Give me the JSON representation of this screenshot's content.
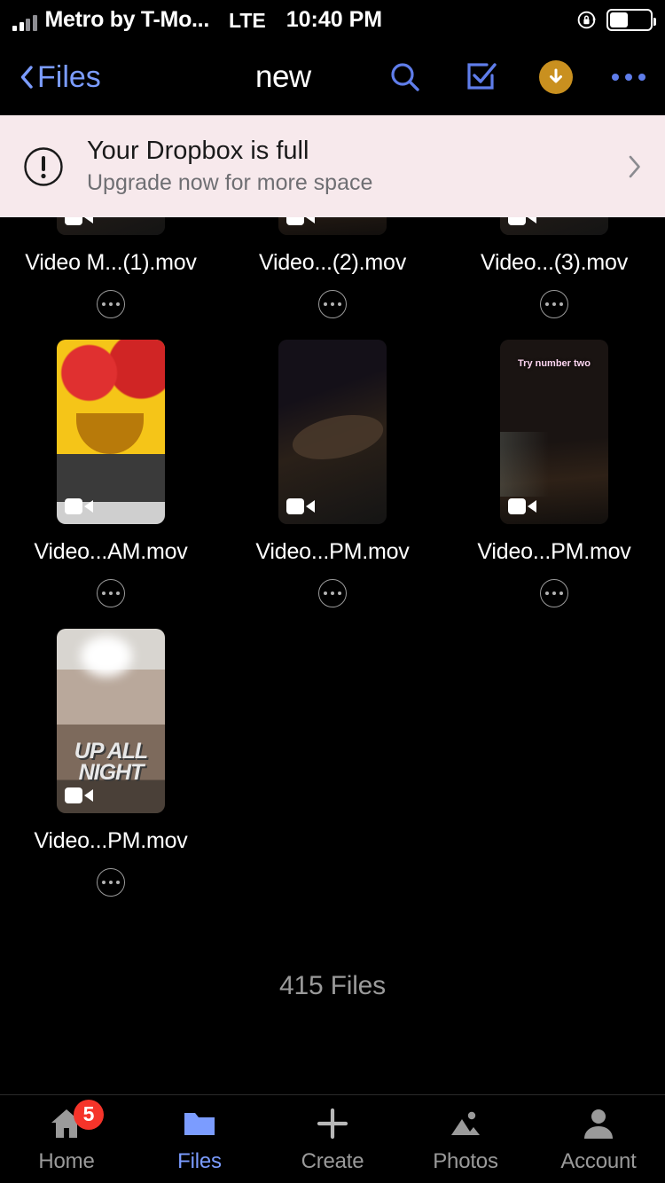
{
  "status_bar": {
    "carrier": "Metro by T-Mo...",
    "network": "LTE",
    "time": "10:40 PM",
    "signal_icon": "signal-bars-icon",
    "rotation_lock_icon": "rotation-lock-icon",
    "battery_icon": "battery-icon",
    "battery_level_pct": 45
  },
  "nav_bar": {
    "back_label": "Files",
    "back_icon": "chevron-left-icon",
    "title": "new",
    "search_icon": "search-icon",
    "select_icon": "checkbox-select-icon",
    "download_icon": "download-arrow-icon",
    "more_icon": "more-horizontal-icon",
    "accent": "#7b9cff",
    "download_bg": "#c9901f"
  },
  "banner": {
    "icon": "exclamation-circle-icon",
    "title": "Your Dropbox is full",
    "subtitle": "Upgrade now for more space",
    "chevron_icon": "chevron-right-icon",
    "bg": "#f7e9ec"
  },
  "grid": {
    "more_icon": "more-horizontal-icon",
    "video_badge_icon": "video-camera-icon",
    "rows": [
      {
        "clipped": true,
        "items": [
          {
            "name": "Video M...(1).mov",
            "art": "art-dark1",
            "overlay": "",
            "overlay_big": ""
          },
          {
            "name": "Video...(2).mov",
            "art": "art-dark2",
            "overlay": "",
            "overlay_big": ""
          },
          {
            "name": "Video...(3).mov",
            "art": "art-dark1",
            "overlay": "",
            "overlay_big": ""
          }
        ]
      },
      {
        "clipped": false,
        "items": [
          {
            "name": "Video...AM.mov",
            "art": "art-emoji",
            "overlay": "",
            "overlay_big": ""
          },
          {
            "name": "Video...PM.mov",
            "art": "art-dark1",
            "overlay": "",
            "overlay_big": ""
          },
          {
            "name": "Video...PM.mov",
            "art": "art-dark2",
            "overlay": "Try number two",
            "overlay_big": ""
          }
        ]
      },
      {
        "clipped": false,
        "items": [
          {
            "name": "Video...PM.mov",
            "art": "art-night",
            "overlay": "",
            "overlay_big": "UP ALL NIGHT"
          }
        ]
      }
    ],
    "file_count_label": "415 Files"
  },
  "tab_bar": {
    "items": [
      {
        "label": "Home",
        "icon": "home-icon",
        "active": false,
        "badge": "5"
      },
      {
        "label": "Files",
        "icon": "folder-icon",
        "active": true,
        "badge": ""
      },
      {
        "label": "Create",
        "icon": "plus-icon",
        "active": false,
        "badge": ""
      },
      {
        "label": "Photos",
        "icon": "photos-mountain-icon",
        "active": false,
        "badge": ""
      },
      {
        "label": "Account",
        "icon": "person-icon",
        "active": false,
        "badge": ""
      }
    ],
    "badge_color": "#f5342a",
    "active_color": "#7b9cff",
    "inactive_color": "#9a9a9a"
  }
}
